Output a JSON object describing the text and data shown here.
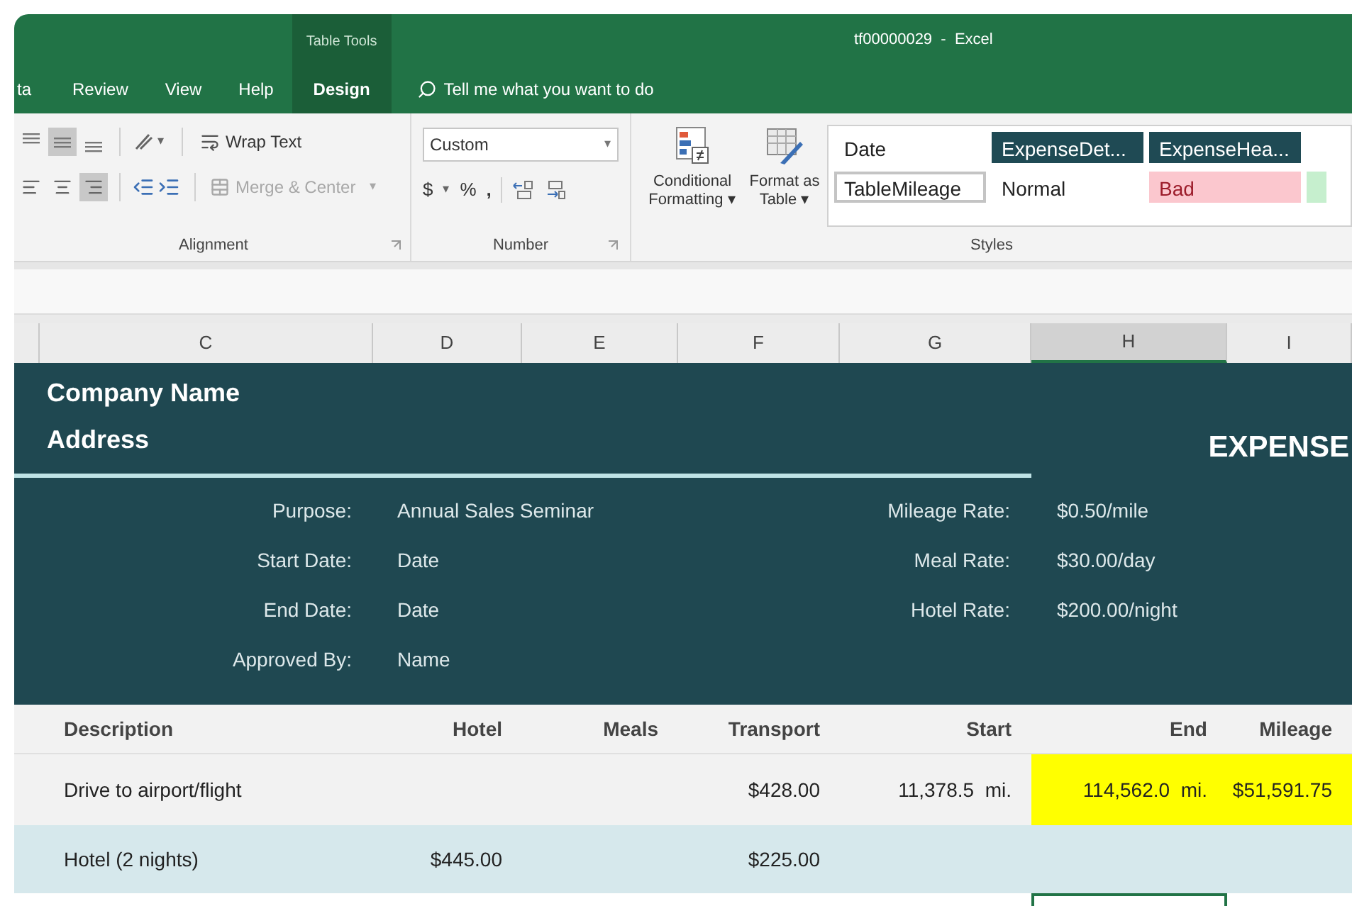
{
  "title_bar": {
    "context_label": "Table Tools",
    "title": "tf00000029  -  Excel"
  },
  "tabs": [
    {
      "label": "ta",
      "selected": false
    },
    {
      "label": "Review",
      "selected": false
    },
    {
      "label": "View",
      "selected": false
    },
    {
      "label": "Help",
      "selected": false
    },
    {
      "label": "Design",
      "selected": true
    }
  ],
  "tell_me": {
    "placeholder": "Tell me what you want to do"
  },
  "alignment": {
    "label": "Alignment",
    "vertical": [
      {
        "selected": false
      },
      {
        "selected": true
      },
      {
        "selected": false
      }
    ],
    "horizontal": [
      {
        "selected": false
      },
      {
        "selected": false
      },
      {
        "selected": true
      }
    ],
    "orientation_caret": "▾",
    "wrap_text": "Wrap Text",
    "merge": {
      "label": "Merge & Center",
      "caret": "▾",
      "disabled": true
    }
  },
  "number": {
    "label": "Number",
    "format": "Custom",
    "format_caret": "▾",
    "currency": "$",
    "currency_caret": "▾",
    "percent": "%",
    "comma": ","
  },
  "styles": {
    "label": "Styles",
    "conditional": "Conditional Formatting ▾",
    "format_table": "Format as Table ▾",
    "cells": [
      {
        "label": "Date",
        "kind": "plain",
        "selected": false
      },
      {
        "label": "ExpenseDet...",
        "kind": "dark",
        "selected": false
      },
      {
        "label": "ExpenseHea...",
        "kind": "dark",
        "selected": false
      },
      {
        "label": "TableMileage",
        "kind": "plain",
        "selected": true
      },
      {
        "label": "Normal",
        "kind": "plain",
        "selected": false
      },
      {
        "label": "Bad",
        "kind": "bad",
        "selected": false
      },
      {
        "kind": "good",
        "selected": false
      }
    ]
  },
  "columns": [
    {
      "label": "C",
      "selected": false
    },
    {
      "label": "D",
      "selected": false
    },
    {
      "label": "E",
      "selected": false
    },
    {
      "label": "F",
      "selected": false
    },
    {
      "label": "G",
      "selected": false
    },
    {
      "label": "H",
      "selected": true
    },
    {
      "label": "I",
      "selected": false
    }
  ],
  "header": {
    "company": "Company Name",
    "address": "Address",
    "title": "EXPENSE",
    "details_left": [
      {
        "label": "Purpose:",
        "value": "Annual Sales Seminar"
      },
      {
        "label": "Start Date:",
        "value": "Date"
      },
      {
        "label": "End Date:",
        "value": "Date"
      },
      {
        "label": "Approved By:",
        "value": "Name"
      }
    ],
    "details_right": [
      {
        "label": "Mileage Rate:",
        "value": "$0.50/mile"
      },
      {
        "label": "Meal Rate:",
        "value": "$30.00/day"
      },
      {
        "label": "Hotel Rate:",
        "value": "$200.00/night"
      }
    ]
  },
  "table": {
    "columns": [
      "Description",
      "Hotel",
      "Meals",
      "Transport",
      "Start",
      "End",
      "Mileage"
    ],
    "rows": [
      {
        "banded": false,
        "cells": [
          {
            "text": "Drive to airport/flight",
            "highlighted": false
          },
          {
            "highlighted": false
          },
          {
            "highlighted": false
          },
          {
            "text": "$428.00",
            "highlighted": false
          },
          {
            "text": "11,378.5  mi.",
            "highlighted": false
          },
          {
            "text": "114,562.0  mi.",
            "highlighted": true
          },
          {
            "text": "$51,591.75",
            "highlighted": true
          }
        ]
      },
      {
        "banded": true,
        "cells": [
          {
            "text": "Hotel (2 nights)",
            "highlighted": false
          },
          {
            "text": "$445.00",
            "highlighted": false
          },
          {
            "highlighted": false
          },
          {
            "text": "$225.00",
            "highlighted": false
          },
          {
            "highlighted": false
          },
          {
            "highlighted": false
          },
          {
            "highlighted": false
          }
        ]
      }
    ]
  }
}
